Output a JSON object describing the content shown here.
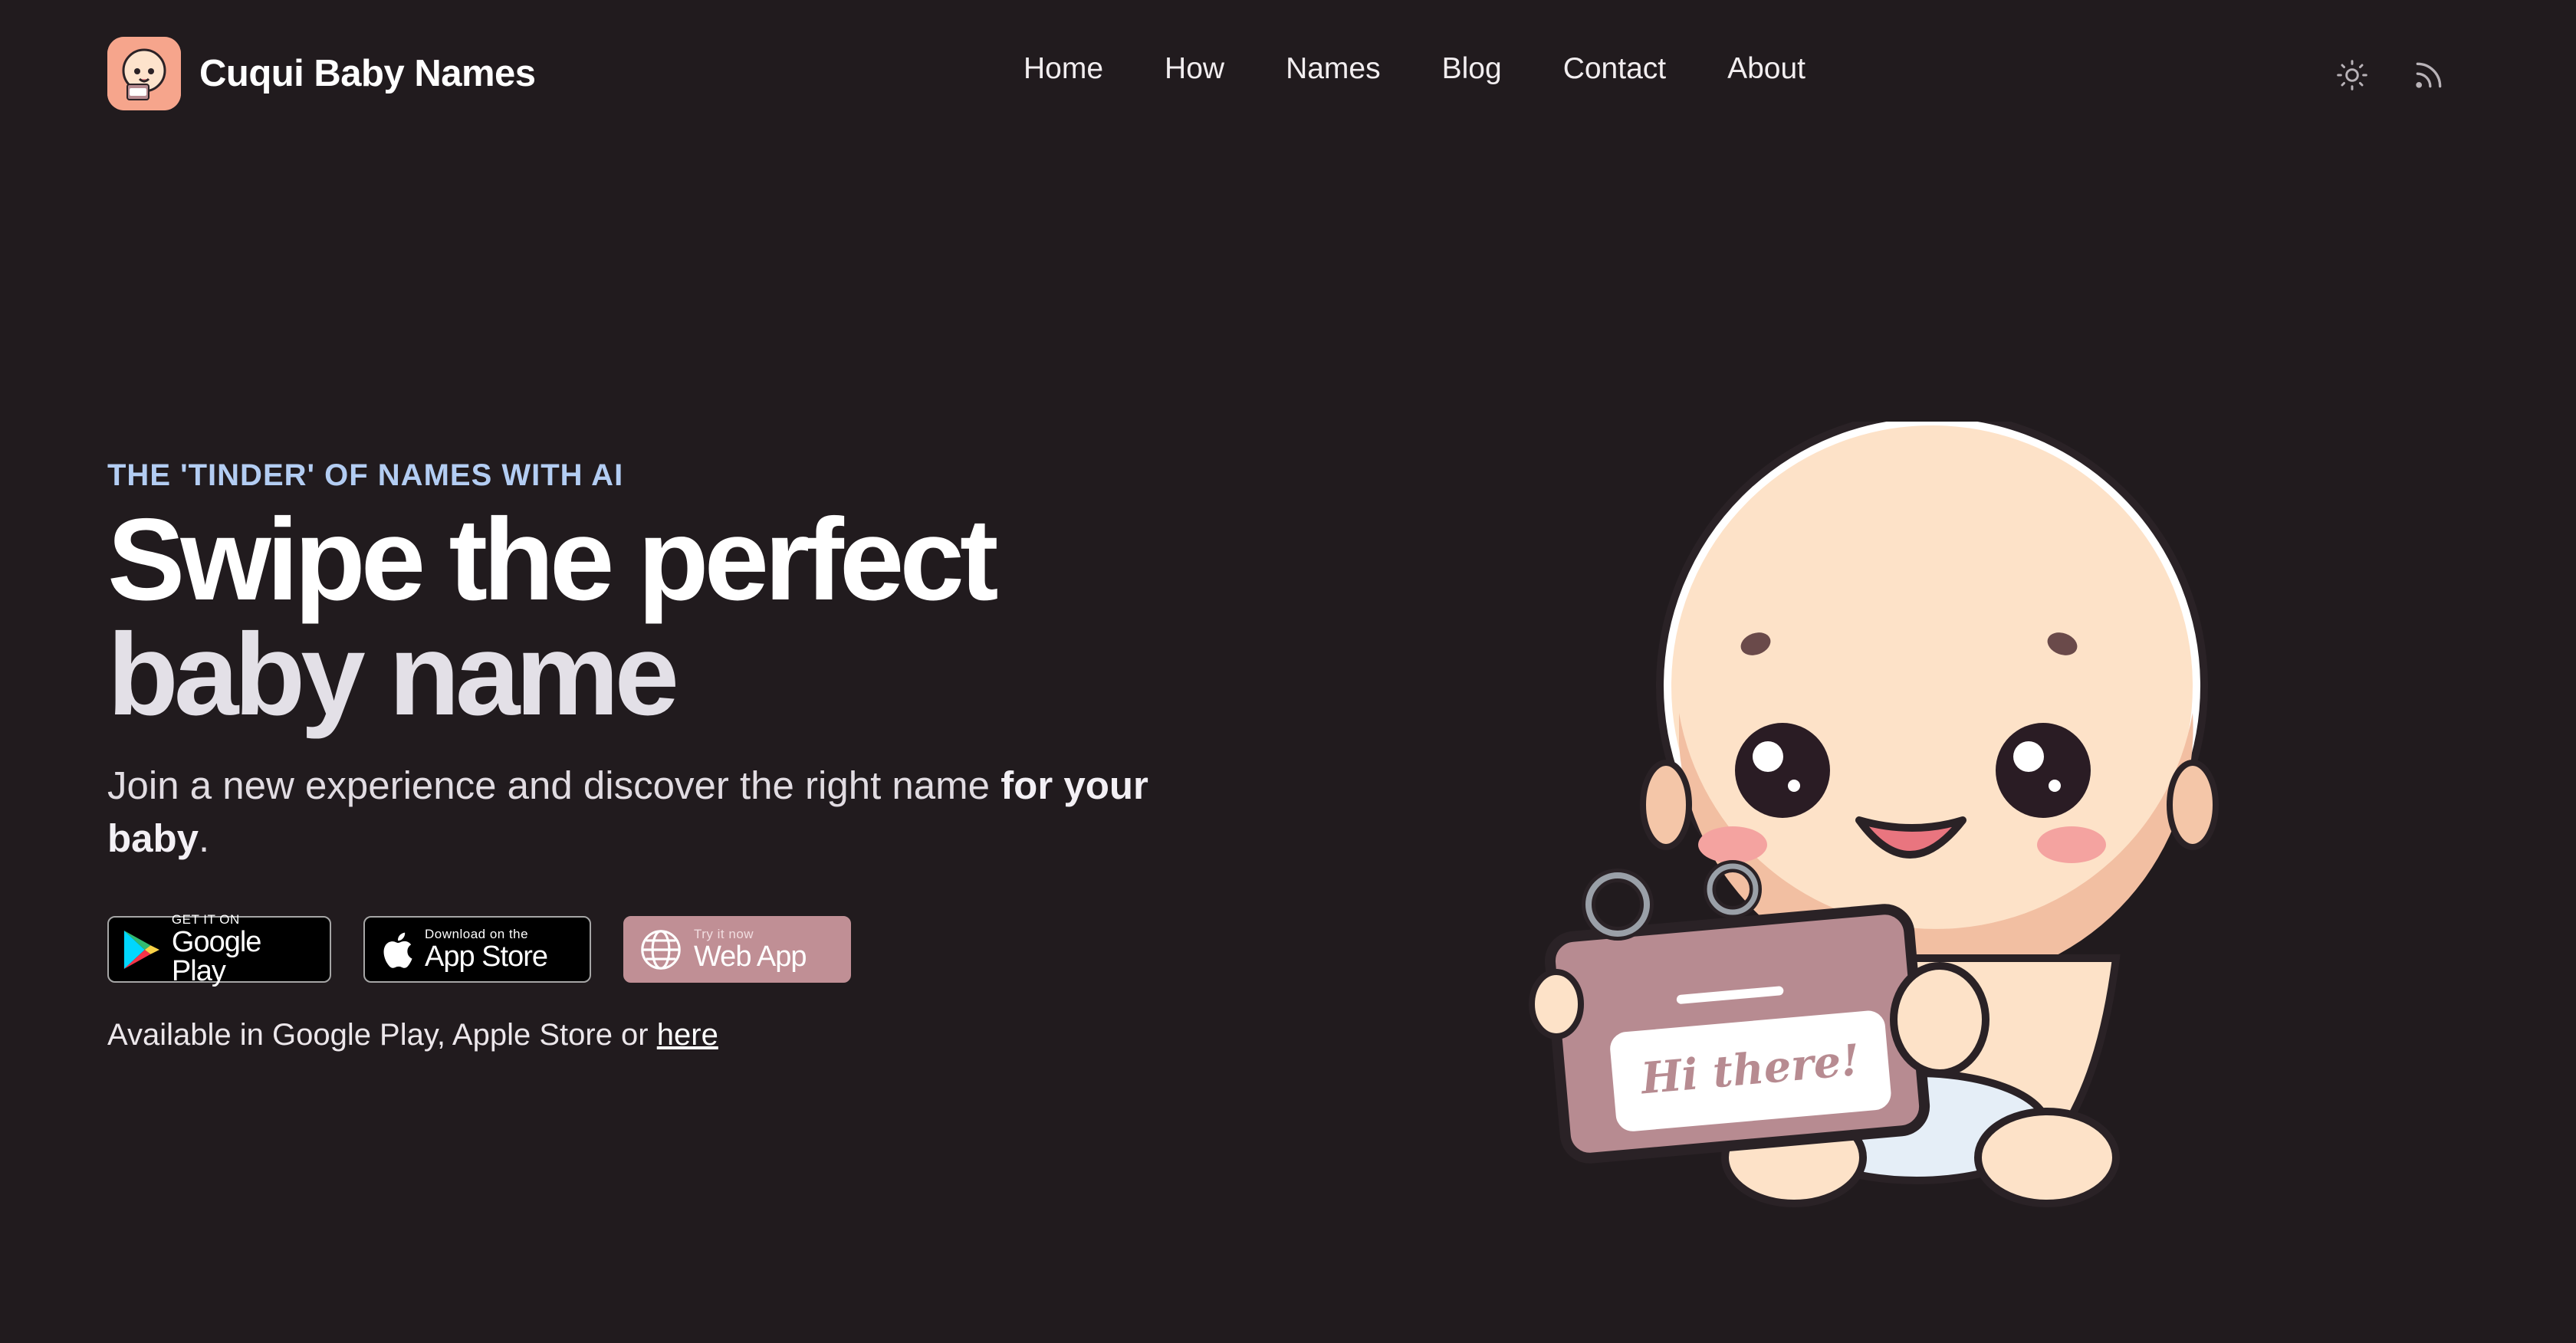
{
  "brand": {
    "name": "Cuqui Baby Names",
    "logo_icon": "baby-face-icon"
  },
  "nav": {
    "items": [
      "Home",
      "How",
      "Names",
      "Blog",
      "Contact",
      "About"
    ]
  },
  "header_icons": {
    "theme": "sun-icon",
    "feed": "rss-icon"
  },
  "hero": {
    "eyebrow": "THE 'TINDER' OF NAMES WITH AI",
    "headline_line1": "Swipe the perfect",
    "headline_line2": "baby name",
    "subtitle_part1": "Join a new experience and discover the right name ",
    "subtitle_bold": "for your baby",
    "subtitle_end": "."
  },
  "stores": {
    "google_play": {
      "small": "GET IT ON",
      "big": "Google Play"
    },
    "app_store": {
      "small": "Download on the",
      "big": "App Store"
    },
    "web_app": {
      "small": "Try it now",
      "big": "Web App"
    }
  },
  "availability": {
    "text": "Available in Google Play, Apple Store or ",
    "link": "here"
  },
  "mascot": {
    "sign_text": "Hi there!"
  },
  "colors": {
    "background": "#211b1e",
    "accent": "#c08f95",
    "eyebrow": "#b3cdf3"
  }
}
